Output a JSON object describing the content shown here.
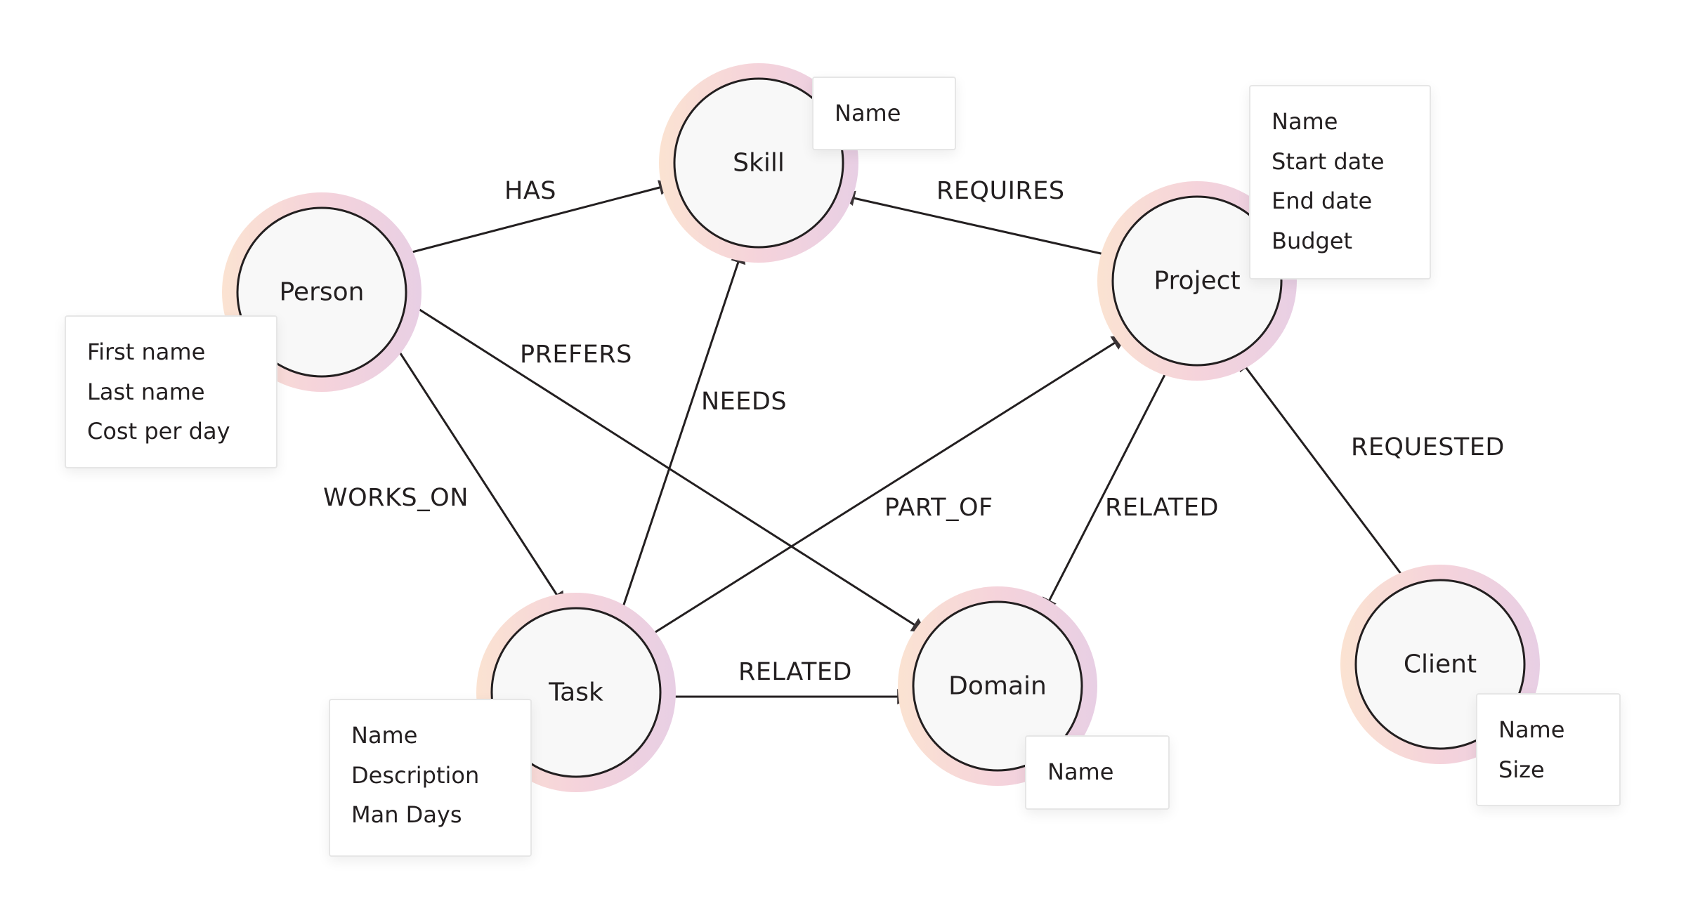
{
  "colors": {
    "ring_start": "#fbe3d2",
    "ring_mid": "#f5d3db",
    "ring_end": "#e8cfe4",
    "node_fill": "#f8f8f8",
    "stroke": "#231f20"
  },
  "nodes": [
    {
      "id": "person",
      "label": "Person",
      "properties": [
        "First name",
        "Last name",
        "Cost per day"
      ]
    },
    {
      "id": "skill",
      "label": "Skill",
      "properties": [
        "Name"
      ]
    },
    {
      "id": "project",
      "label": "Project",
      "properties": [
        "Name",
        "Start date",
        "End date",
        "Budget"
      ]
    },
    {
      "id": "task",
      "label": "Task",
      "properties": [
        "Name",
        "Description",
        "Man Days"
      ]
    },
    {
      "id": "domain",
      "label": "Domain",
      "properties": [
        "Name"
      ]
    },
    {
      "id": "client",
      "label": "Client",
      "properties": [
        "Name",
        "Size"
      ]
    }
  ],
  "edges": [
    {
      "id": "has",
      "label": "HAS",
      "from": "person",
      "to": "skill"
    },
    {
      "id": "requires",
      "label": "REQUIRES",
      "from": "project",
      "to": "skill"
    },
    {
      "id": "prefers",
      "label": "PREFERS",
      "from": "person",
      "to": "domain"
    },
    {
      "id": "works-on",
      "label": "WORKS_ON",
      "from": "person",
      "to": "task"
    },
    {
      "id": "needs",
      "label": "NEEDS",
      "from": "task",
      "to": "skill"
    },
    {
      "id": "part-of",
      "label": "PART_OF",
      "from": "task",
      "to": "project"
    },
    {
      "id": "related-pd",
      "label": "RELATED",
      "from": "project",
      "to": "domain"
    },
    {
      "id": "related-td",
      "label": "RELATED",
      "from": "task",
      "to": "domain"
    },
    {
      "id": "requested",
      "label": "REQUESTED",
      "from": "client",
      "to": "project"
    }
  ]
}
